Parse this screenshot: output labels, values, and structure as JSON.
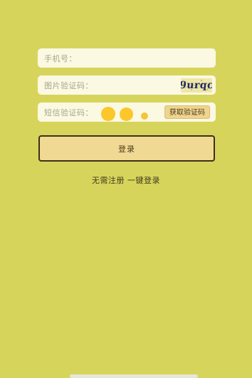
{
  "form": {
    "phone_label": "手机号：",
    "image_captcha_label": "图片验证码：",
    "sms_code_label": "短信验证码：",
    "captcha_text": "9urqc",
    "get_sms_code_button": "获取验证码"
  },
  "login_button": "登录",
  "quick_login_link": "无需注册 一键登录",
  "colors": {
    "background": "#d7d45c",
    "input_bg": "#fbf9e2",
    "button_bg": "#f0d993",
    "button_border": "#3e3018",
    "loading_dots": "#fbc72b"
  }
}
